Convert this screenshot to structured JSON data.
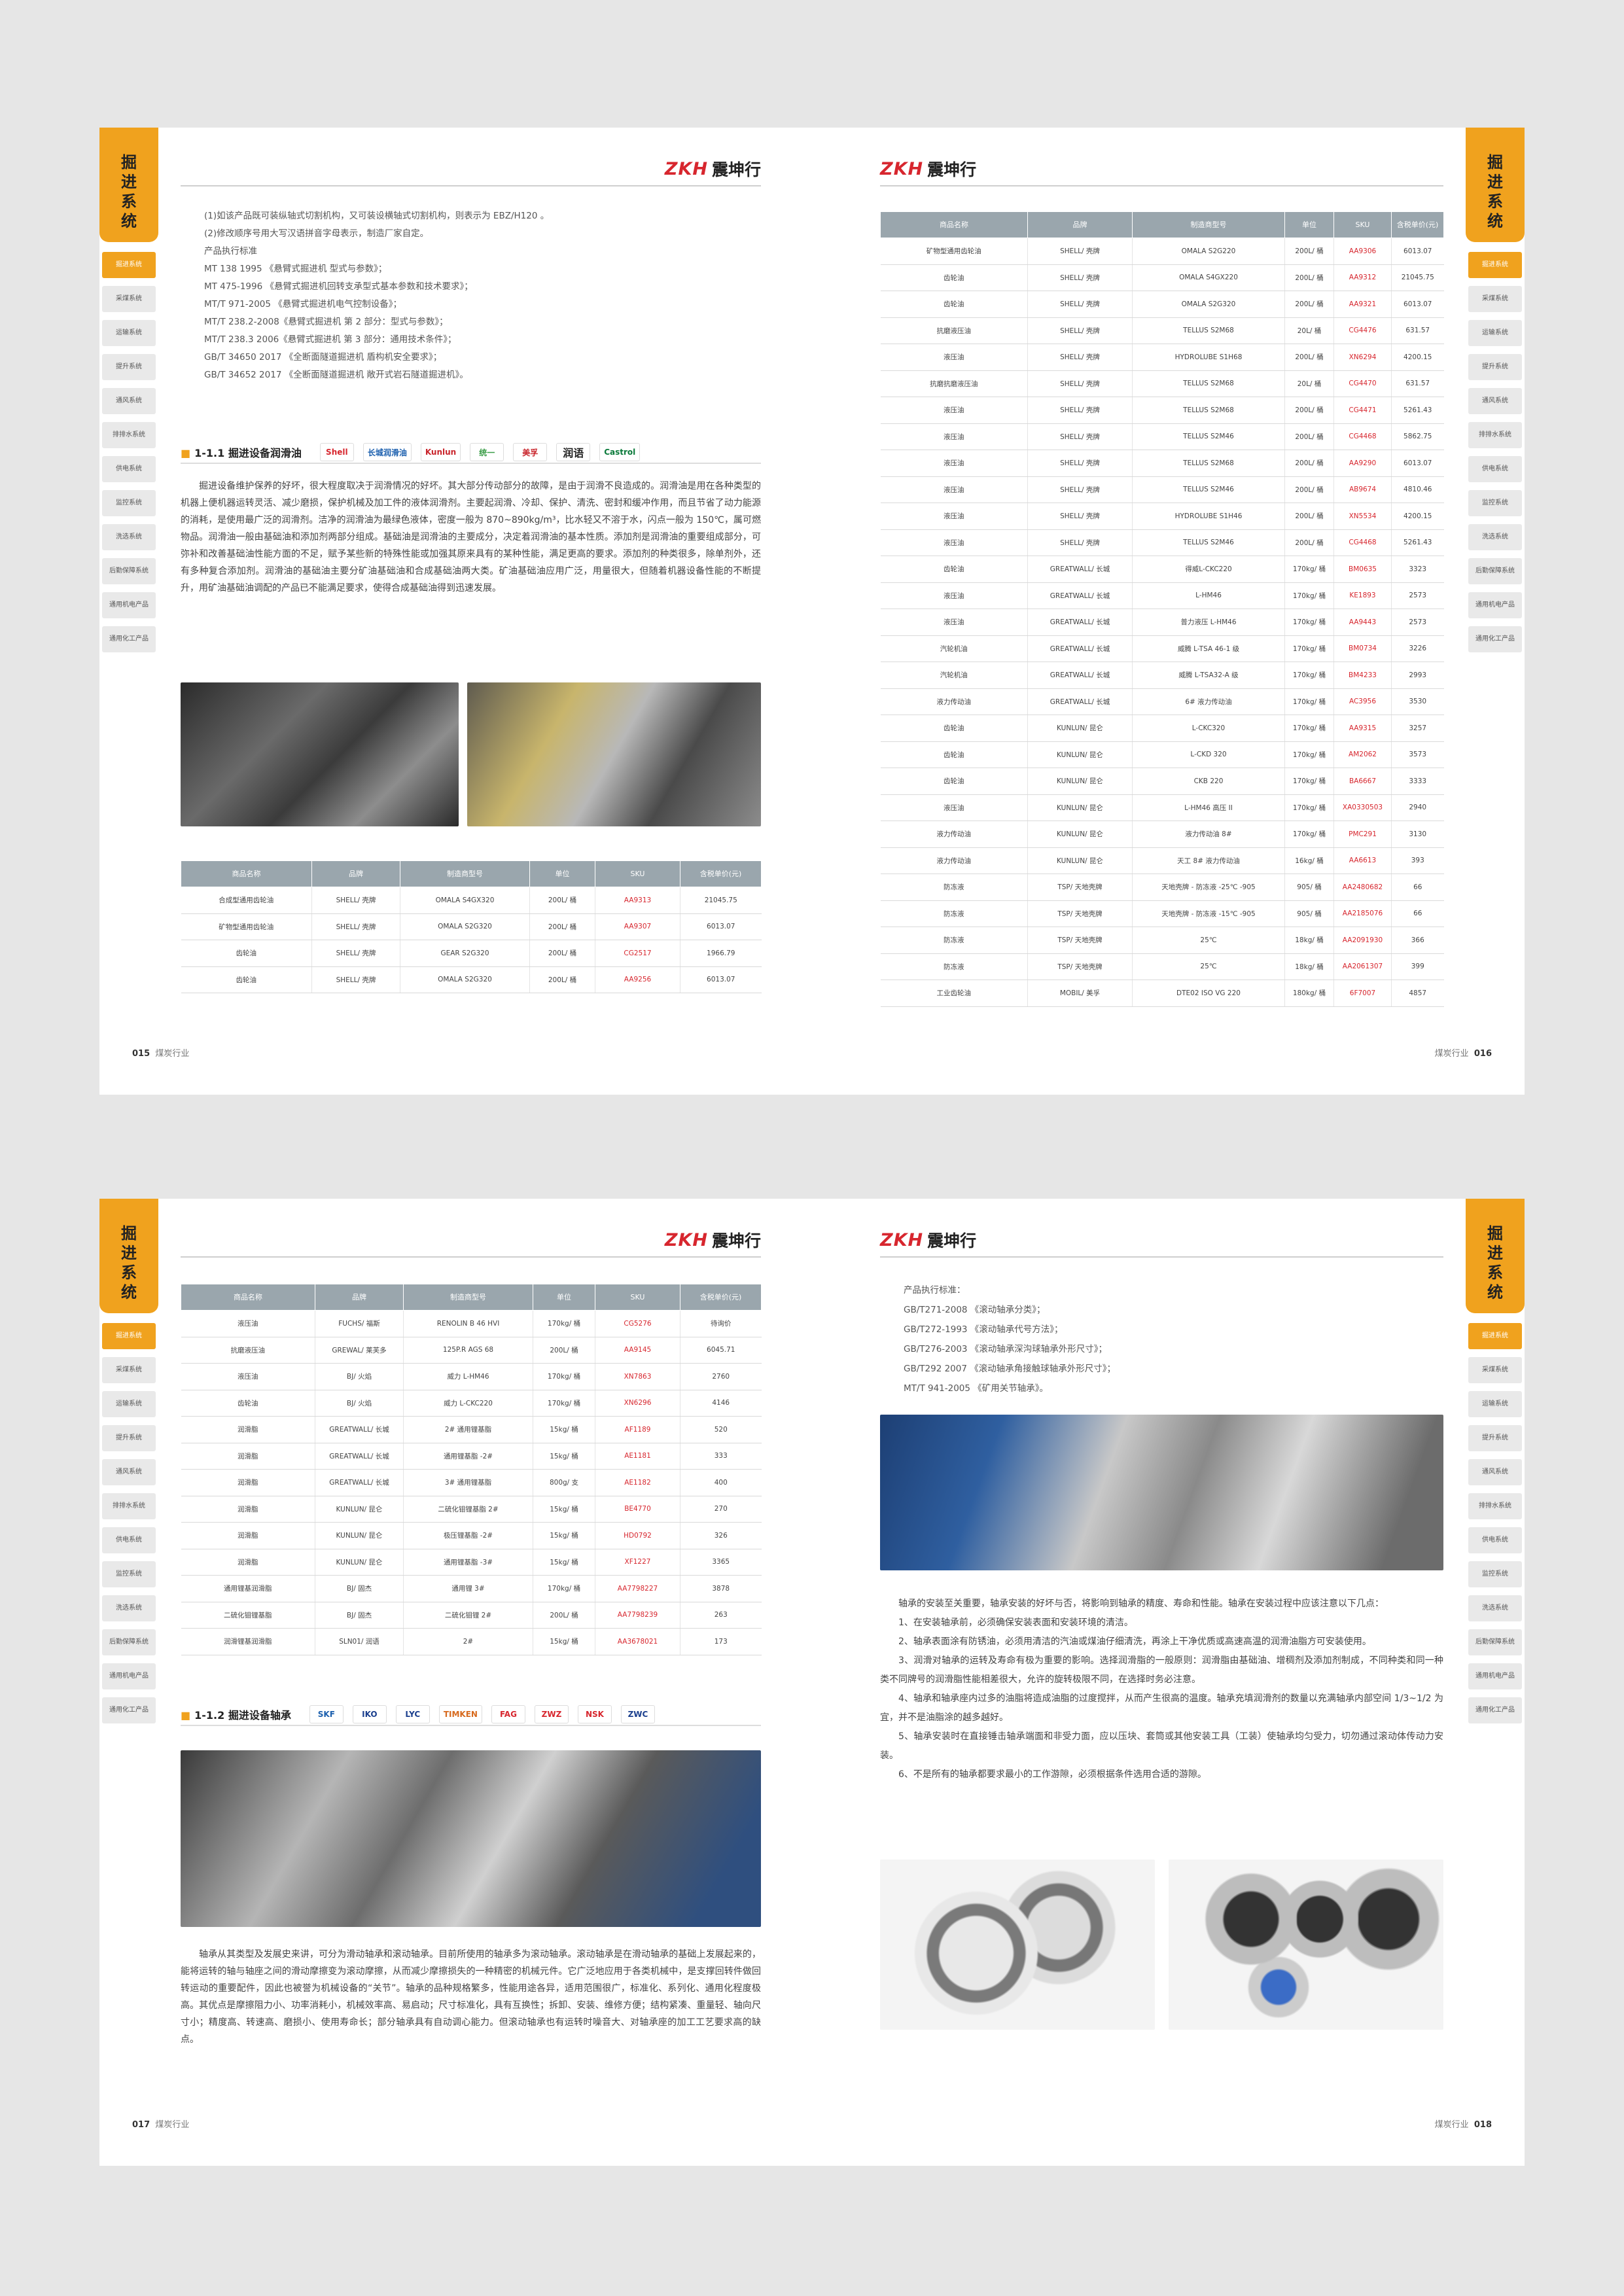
{
  "brand": {
    "logo_letters": "ZKH",
    "logo_cn": "震坤行"
  },
  "tab_title": "掘进系统",
  "sidebar": [
    "掘进系统",
    "采煤系统",
    "运输系统",
    "提升系统",
    "通风系统",
    "排排水系统",
    "供电系统",
    "监控系统",
    "洗选系统",
    "后勤保障系统",
    "通用机电产品",
    "通用化工产品"
  ],
  "footer": {
    "industry": "煤炭行业",
    "p15": "015",
    "p16": "016",
    "p17": "017",
    "p18": "018"
  },
  "p15": {
    "intro": [
      "(1)如该产品既可装纵轴式切割机构，又可装设横轴式切割机构，则表示为 EBZ/H120 。",
      "(2)修改顺序号用大写汉语拼音字母表示，制造厂家自定。",
      "产品执行标准",
      "MT 138 1995 《悬臂式掘进机 型式与参数》；",
      "MT 475-1996 《悬臂式掘进机回转支承型式基本参数和技术要求》；",
      "MT/T 971-2005 《悬臂式掘进机电气控制设备》；",
      "MT/T 238.2-2008《悬臂式掘进机 第 2 部分：型式与参数》；",
      "MT/T 238.3 2006《悬臂式掘进机 第 3 部分：通用技术条件》；",
      "GB/T 34650 2017 《全断面隧道掘进机 盾构机安全要求》；",
      "GB/T 34652 2017 《全断面隧道掘进机 敞开式岩石隧道掘进机》。"
    ],
    "section": "1-1.1 掘进设备润滑油",
    "brands": [
      "Shell",
      "长城润滑油",
      "Kunlun",
      "统一",
      "美孚",
      "润语",
      "Castrol"
    ],
    "body": "掘进设备维护保养的好坏，很大程度取决于润滑情况的好坏。其大部分传动部分的故障，是由于润滑不良造成的。润滑油是用在各种类型的机器上便机器运转灵活、减少磨损，保护机械及加工件的液体润滑剂。主要起润滑、冷却、保护、清洗、密封和缓冲作用，而且节省了动力能源的消耗，是使用最广泛的润滑剂。洁净的润滑油为最绿色液体，密度一般为 870~890kg/m³，比水轻又不溶于水，闪点一般为 150℃，属可燃物品。润滑油一般由基础油和添加剂两部分组成。基础油是润滑油的主要成分，决定着润滑油的基本性质。添加剂是润滑油的重要组成部分，可弥补和改善基础油性能方面的不足，赋予某些新的特殊性能或加强其原来具有的某种性能，满足更高的要求。添加剂的种类很多，除单剂外，还有多种复合添加剂。润滑油的基础油主要分矿油基础油和合成基础油两大类。矿油基础油应用广泛，用量很大，但随着机器设备性能的不断提升，用矿油基础油调配的产品已不能满足要求，使得合成基础油得到迅速发展。",
    "table": {
      "headers": [
        "商品名称",
        "品牌",
        "制造商型号",
        "单位",
        "SKU",
        "含税单价(元)"
      ],
      "rows": [
        [
          "合成型通用齿轮油",
          "SHELL/ 壳牌",
          "OMALA S4GX320",
          "200L/ 桶",
          "AA9313",
          "21045.75"
        ],
        [
          "矿物型通用齿轮油",
          "SHELL/ 壳牌",
          "OMALA S2G320",
          "200L/ 桶",
          "AA9307",
          "6013.07"
        ],
        [
          "齿轮油",
          "SHELL/ 壳牌",
          "GEAR S2G320",
          "200L/ 桶",
          "CG2517",
          "1966.79"
        ],
        [
          "齿轮油",
          "SHELL/ 壳牌",
          "OMALA S2G320",
          "200L/ 桶",
          "AA9256",
          "6013.07"
        ]
      ]
    }
  },
  "p16": {
    "table": {
      "headers": [
        "商品名称",
        "品牌",
        "制造商型号",
        "单位",
        "SKU",
        "含税单价(元)"
      ],
      "rows": [
        [
          "矿物型通用齿轮油",
          "SHELL/ 壳牌",
          "OMALA S2G220",
          "200L/ 桶",
          "AA9306",
          "6013.07"
        ],
        [
          "齿轮油",
          "SHELL/ 壳牌",
          "OMALA S4GX220",
          "200L/ 桶",
          "AA9312",
          "21045.75"
        ],
        [
          "齿轮油",
          "SHELL/ 壳牌",
          "OMALA S2G320",
          "200L/ 桶",
          "AA9321",
          "6013.07"
        ],
        [
          "抗磨液压油",
          "SHELL/ 壳牌",
          "TELLUS S2M68",
          "20L/ 桶",
          "CG4476",
          "631.57"
        ],
        [
          "液压油",
          "SHELL/ 壳牌",
          "HYDROLUBE S1H68",
          "200L/ 桶",
          "XN6294",
          "4200.15"
        ],
        [
          "抗磨抗磨液压油",
          "SHELL/ 壳牌",
          "TELLUS S2M68",
          "20L/ 桶",
          "CG4470",
          "631.57"
        ],
        [
          "液压油",
          "SHELL/ 壳牌",
          "TELLUS S2M68",
          "200L/ 桶",
          "CG4471",
          "5261.43"
        ],
        [
          "液压油",
          "SHELL/ 壳牌",
          "TELLUS S2M46",
          "200L/ 桶",
          "CG4468",
          "5862.75"
        ],
        [
          "液压油",
          "SHELL/ 壳牌",
          "TELLUS S2M68",
          "200L/ 桶",
          "AA9290",
          "6013.07"
        ],
        [
          "液压油",
          "SHELL/ 壳牌",
          "TELLUS S2M46",
          "200L/ 桶",
          "AB9674",
          "4810.46"
        ],
        [
          "液压油",
          "SHELL/ 壳牌",
          "HYDROLUBE S1H46",
          "200L/ 桶",
          "XN5534",
          "4200.15"
        ],
        [
          "液压油",
          "SHELL/ 壳牌",
          "TELLUS S2M46",
          "200L/ 桶",
          "CG4468",
          "5261.43"
        ],
        [
          "齿轮油",
          "GREATWALL/ 长城",
          "得威L-CKC220",
          "170kg/ 桶",
          "BM0635",
          "3323"
        ],
        [
          "液压油",
          "GREATWALL/ 长城",
          "L-HM46",
          "170kg/ 桶",
          "KE1893",
          "2573"
        ],
        [
          "液压油",
          "GREATWALL/ 长城",
          "普力液压 L-HM46",
          "170kg/ 桶",
          "AA9443",
          "2573"
        ],
        [
          "汽轮机油",
          "GREATWALL/ 长城",
          "威腾 L-TSA 46-1 级",
          "170kg/ 桶",
          "BM0734",
          "3226"
        ],
        [
          "汽轮机油",
          "GREATWALL/ 长城",
          "威腾 L-TSA32-A 级",
          "170kg/ 桶",
          "BM4233",
          "2993"
        ],
        [
          "液力传动油",
          "GREATWALL/ 长城",
          "6# 液力传动油",
          "170kg/ 桶",
          "AC3956",
          "3530"
        ],
        [
          "齿轮油",
          "KUNLUN/ 昆仑",
          "L-CKC320",
          "170kg/ 桶",
          "AA9315",
          "3257"
        ],
        [
          "齿轮油",
          "KUNLUN/ 昆仑",
          "L-CKD 320",
          "170kg/ 桶",
          "AM2062",
          "3573"
        ],
        [
          "齿轮油",
          "KUNLUN/ 昆仑",
          "CKB 220",
          "170kg/ 桶",
          "BA6667",
          "3333"
        ],
        [
          "液压油",
          "KUNLUN/ 昆仑",
          "L-HM46 高压 II",
          "170kg/ 桶",
          "XA0330503",
          "2940"
        ],
        [
          "液力传动油",
          "KUNLUN/ 昆仑",
          "液力传动油 8#",
          "170kg/ 桶",
          "PMC291",
          "3130"
        ],
        [
          "液力传动油",
          "KUNLUN/ 昆仑",
          "天工 8# 液力传动油",
          "16kg/ 桶",
          "AA6613",
          "393"
        ],
        [
          "防冻液",
          "TSP/ 天地壳牌",
          "天地壳牌 - 防冻液 -25℃ -905",
          "905/ 桶",
          "AA2480682",
          "66"
        ],
        [
          "防冻液",
          "TSP/ 天地壳牌",
          "天地壳牌 - 防冻液 -15℃ -905",
          "905/ 桶",
          "AA2185076",
          "66"
        ],
        [
          "防冻液",
          "TSP/ 天地壳牌",
          "25℃",
          "18kg/ 桶",
          "AA2091930",
          "366"
        ],
        [
          "防冻液",
          "TSP/ 天地壳牌",
          "25℃",
          "18kg/ 桶",
          "AA2061307",
          "399"
        ],
        [
          "工业齿轮油",
          "MOBIL/ 美孚",
          "DTE02 ISO VG 220",
          "180kg/ 桶",
          "6F7007",
          "4857"
        ]
      ]
    }
  },
  "p17": {
    "table": {
      "headers": [
        "商品名称",
        "品牌",
        "制造商型号",
        "单位",
        "SKU",
        "含税单价(元)"
      ],
      "rows": [
        [
          "液压油",
          "FUCHS/ 福斯",
          "RENOLIN B 46 HVI",
          "170kg/ 桶",
          "CG5276",
          "待询价"
        ],
        [
          "抗磨液压油",
          "GREWAL/ 莱芙多",
          "125P.R AGS 68",
          "200L/ 桶",
          "AA9145",
          "6045.71"
        ],
        [
          "液压油",
          "BJ/ 火焰",
          "威力 L-HM46",
          "170kg/ 桶",
          "XN7863",
          "2760"
        ],
        [
          "齿轮油",
          "BJ/ 火焰",
          "威力 L-CKC220",
          "170kg/ 桶",
          "XN6296",
          "4146"
        ],
        [
          "润滑脂",
          "GREATWALL/ 长城",
          "2# 通用锂基脂",
          "15kg/ 桶",
          "AF1189",
          "520"
        ],
        [
          "润滑脂",
          "GREATWALL/ 长城",
          "通用锂基脂 -2#",
          "15kg/ 桶",
          "AE1181",
          "333"
        ],
        [
          "润滑脂",
          "GREATWALL/ 长城",
          "3# 通用锂基脂",
          "800g/ 支",
          "AE1182",
          "400"
        ],
        [
          "润滑脂",
          "KUNLUN/ 昆仑",
          "二硫化钼锂基脂 2#",
          "15kg/ 桶",
          "BE4770",
          "270"
        ],
        [
          "润滑脂",
          "KUNLUN/ 昆仑",
          "极压锂基脂 -2#",
          "15kg/ 桶",
          "HD0792",
          "326"
        ],
        [
          "润滑脂",
          "KUNLUN/ 昆仑",
          "通用锂基脂 -3#",
          "15kg/ 桶",
          "XF1227",
          "3365"
        ],
        [
          "通用锂基润滑脂",
          "BJ/ 固杰",
          "通用锂 3#",
          "170kg/ 桶",
          "AA7798227",
          "3878"
        ],
        [
          "二硫化钼锂基脂",
          "BJ/ 固杰",
          "二硫化钼锂 2#",
          "200L/ 桶",
          "AA7798239",
          "263"
        ],
        [
          "润滑锂基润滑脂",
          "SLN01/ 润语",
          "2#",
          "15kg/ 桶",
          "AA3678021",
          "173"
        ]
      ]
    },
    "section": "1-1.2 掘进设备轴承",
    "brands": [
      "SKF",
      "IKO",
      "LYC",
      "TIMKEN",
      "FAG",
      "ZWZ",
      "NSK",
      "ZWC"
    ],
    "body": "轴承从其类型及发展史来讲，可分为滑动轴承和滚动轴承。目前所使用的轴承多为滚动轴承。滚动轴承是在滑动轴承的基础上发展起来的，能将运转的轴与轴座之间的滑动摩擦变为滚动摩擦，从而减少摩擦损失的一种精密的机械元件。它广泛地应用于各类机械中，是支撑回转件做回转运动的重要配件，因此也被誉为机械设备的“关节”。轴承的品种规格繁多，性能用途各异，适用范围很广，标准化、系列化、通用化程度极高。其优点是摩擦阻力小、功率消耗小，机械效率高、易启动；尺寸标准化，具有互换性；拆卸、安装、维修方便；结构紧凑、重量轻、轴向尺寸小；精度高、转速高、磨损小、使用寿命长；部分轴承具有自动调心能力。但滚动轴承也有运转时噪音大、对轴承座的加工工艺要求高的缺点。"
  },
  "p18": {
    "standards": [
      "产品执行标准：",
      "GB/T271-2008 《滚动轴承分类》；",
      "GB/T272-1993 《滚动轴承代号方法》；",
      "GB/T276-2003 《滚动轴承深沟球轴承外形尺寸》；",
      "GB/T292 2007 《滚动轴承角接触球轴承外形尺寸》；",
      "MT/T 941-2005 《矿用关节轴承》。"
    ],
    "body": [
      "轴承的安装至关重要，轴承安装的好坏与否，将影响到轴承的精度、寿命和性能。轴承在安装过程中应该注意以下几点：",
      "1、在安装轴承前，必须确保安装表面和安装环境的清洁。",
      "2、轴承表面涂有防锈油，必须用清洁的汽油或煤油仔细清洗，再涂上干净优质或高速高温的润滑油脂方可安装使用。",
      "3、润滑对轴承的运转及寿命有极为重要的影响。选择润滑脂的一般原则：润滑脂由基础油、增稠剂及添加剂制成，不同种类和同一种类不同牌号的润滑脂性能相差很大，允许的旋转极限不同，在选择时务必注意。",
      "4、轴承和轴承座内过多的油脂将造成油脂的过度搅拌，从而产生很高的温度。轴承充填润滑剂的数量以充满轴承内部空间 1/3~1/2 为宜，并不是油脂涂的越多越好。",
      "5、轴承安装时在直接锤击轴承端面和非受力面，应以压块、套筒或其他安装工具（工装）使轴承均匀受力，切勿通过滚动体传动力安装。",
      "6、不是所有的轴承都要求最小的工作游隙，必须根据条件选用合适的游隙。"
    ]
  }
}
